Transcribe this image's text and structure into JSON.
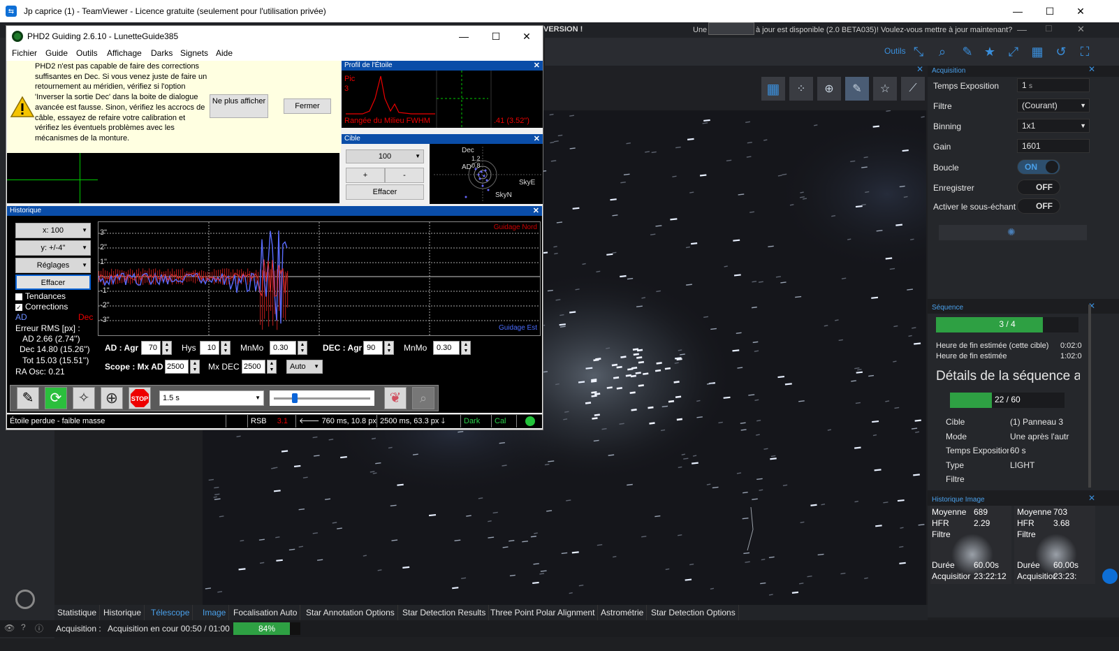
{
  "teamviewer": {
    "title": "Jp caprice (1) - TeamViewer - Licence gratuite (seulement pour l'utilisation privée)",
    "min": "—",
    "max": "☐",
    "close": "✕"
  },
  "nina_top": {
    "version_banner": "VERSION !",
    "update_prefix": "Une",
    "update_msg": "à jour est disponible (2.0 BETA035)! Voulez-vous mettre à jour maintenant?"
  },
  "nina_toolbar": {
    "tools_label": "Outils"
  },
  "phd2": {
    "title": "PHD2 Guiding 2.6.10 - LunetteGuide385",
    "menu": [
      "Fichier",
      "Guide",
      "Outils",
      "Affichage",
      "Darks",
      "Signets",
      "Aide"
    ],
    "alert_text": "PHD2 n'est pas capable de faire des corrections suffisantes en Dec. Si vous venez juste de faire un retournement au méridien, vérifiez si l'option 'Inverser la sortie Dec' dans la boite de dialogue avancée est fausse. Sinon, vérifiez les accrocs de câble, essayez de refaire votre calibration et vérifiez les éventuels problèmes avec les mécanismes de la monture.",
    "btn_dont_show": "Ne plus afficher",
    "btn_close": "Fermer",
    "star_profile": {
      "title": "Profil de l'Étoile",
      "pic_label": "Pic",
      "pic_value": "3",
      "footer": "Rangée du Milieu FWHM",
      "footer_value": ".41 (3.52\")"
    },
    "target": {
      "title": "Cible",
      "scale": "100",
      "plus": "+",
      "minus": "-",
      "clear": "Effacer",
      "dec": "Dec",
      "ad": "AD",
      "sky_e": "SkyE",
      "sky_n": "SkyN",
      "ring_a": "1.2",
      "ring_b": "0.8"
    },
    "history": {
      "title": "Historique",
      "x_scale": "x: 100",
      "y_scale": "y: +/-4''",
      "settings": "Réglages",
      "clear": "Effacer",
      "trends": "Tendances",
      "corrections": "Corrections",
      "ad": "AD",
      "dec": "Dec",
      "rms_label": "Erreur RMS [px] :",
      "rms_ad": "AD  2.66 (2.74'')",
      "rms_dec": "Dec  14.80 (15.26'')",
      "rms_tot": "Tot  15.03 (15.51'')",
      "ra_osc": "RA Osc: 0.21",
      "guide_north": "Guidage Nord",
      "guide_east": "Guidage Est",
      "y_ticks": [
        "3\"",
        "2\"",
        "1\"",
        "-1\"",
        "-2\"",
        "-3\""
      ]
    },
    "params": {
      "ad_agr_label": "AD : Agr",
      "ad_agr": "70",
      "hys_label": "Hys",
      "hys": "10",
      "mnmo_label": "MnMo",
      "mnmo_ad": "0.30",
      "dec_agr_label": "DEC : Agr",
      "dec_agr": "90",
      "mnmo_dec": "0.30",
      "scope_label": "Scope : Mx AD",
      "mx_ad": "2500",
      "mx_dec_label": "Mx DEC",
      "mx_dec": "2500",
      "mode": "Auto"
    },
    "toolbar": {
      "exposure": "1.5 s"
    },
    "status": {
      "msg": "Étoile perdue - faible masse",
      "rsb_label": "RSB",
      "rsb": "3.1",
      "ra_pulse": "760 ms, 10.8 px",
      "dec_pulse": "2500 ms, 63.3 px",
      "dark": "Dark",
      "cal": "Cal"
    }
  },
  "acquisition": {
    "title": "Acquisition",
    "exposure_label": "Temps Exposition",
    "exposure": "1",
    "exposure_unit": "s",
    "filter_label": "Filtre",
    "filter": "(Courant)",
    "binning_label": "Binning",
    "binning": "1x1",
    "gain_label": "Gain",
    "gain": "1601",
    "loop_label": "Boucle",
    "loop": "ON",
    "save_label": "Enregistrer",
    "save": "OFF",
    "subsample_label": "Activer le sous-échant",
    "subsample": "OFF"
  },
  "sequence": {
    "title": "Séquence",
    "progress": "3 / 4",
    "progress_frac": 0.75,
    "end_target_label": "Heure de fin estimée (cette cible)",
    "end_target": "0:02:0",
    "end_label": "Heure de fin estimée",
    "end": "1:02:0",
    "details_title": "Détails de la séquence a",
    "count": "22 / 60",
    "count_frac": 0.3667,
    "target_label": "Cible",
    "target": "(1) Panneau 3",
    "mode_label": "Mode",
    "mode": "Une après l'autr",
    "exp_label": "Temps Expositior",
    "exp": "60 s",
    "type_label": "Type",
    "type": "LIGHT",
    "filter_label": "Filtre"
  },
  "image_history": {
    "title": "Historique Image",
    "cards": [
      {
        "mean_label": "Moyenne",
        "mean": "689",
        "hfr_label": "HFR",
        "hfr": "2.29",
        "filter_label": "Filtre",
        "dur_label": "Durée",
        "dur": "60.00s",
        "acq_label": "Acquisitior",
        "acq": "23:22:12"
      },
      {
        "mean_label": "Moyenne",
        "mean": "703",
        "hfr_label": "HFR",
        "hfr": "3.68",
        "filter_label": "Filtre",
        "dur_label": "Durée",
        "dur": "60.00s",
        "acq_label": "Acquisitior",
        "acq": "23:23:"
      }
    ]
  },
  "tabs_left": [
    "Statistique",
    "Historique",
    "Télescope"
  ],
  "tabs_right": [
    "Image",
    "Focalisation Auto",
    "Star Annotation Options",
    "Star Detection Results",
    "Three Point Polar Alignment",
    "Astrométrie",
    "Star Detection Options"
  ],
  "status": {
    "label": "Acquisition :",
    "value": "Acquisition en cour 00:50 / 01:00",
    "percent": "84%",
    "percent_frac": 0.84
  },
  "colors": {
    "accent_blue": "#3a8fdc",
    "progress_green": "#2ea043",
    "phd_title_blue": "#0a4da8"
  }
}
